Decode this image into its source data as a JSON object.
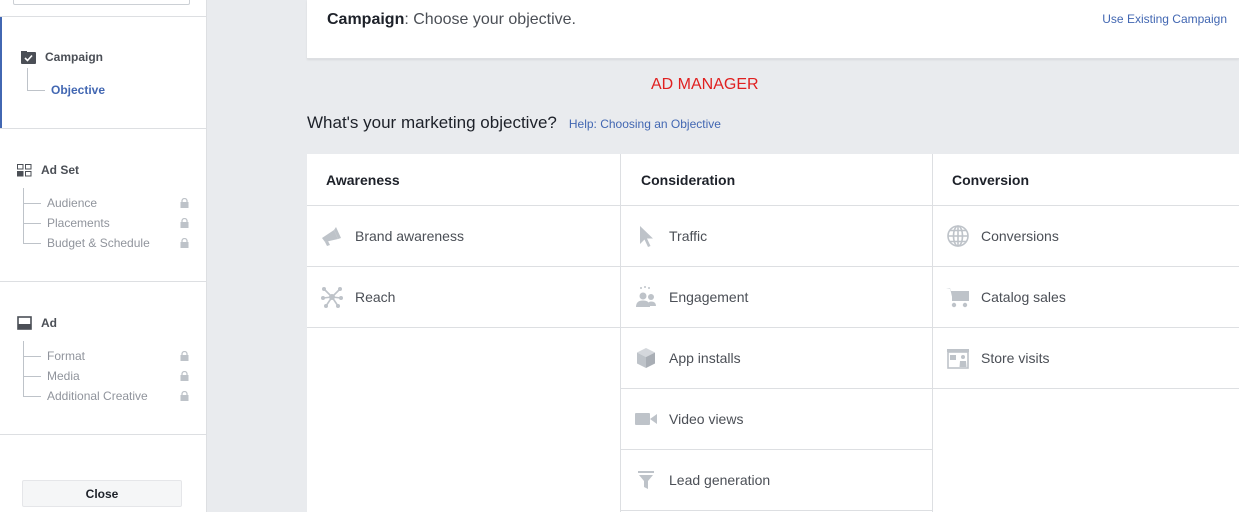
{
  "sidebar": {
    "campaign": {
      "label": "Campaign",
      "icon": "checkbox-icon",
      "items": [
        {
          "label": "Objective",
          "active": true
        }
      ]
    },
    "ad_set": {
      "label": "Ad Set",
      "icon": "grid-icon",
      "items": [
        {
          "label": "Audience",
          "locked": true
        },
        {
          "label": "Placements",
          "locked": true
        },
        {
          "label": "Budget & Schedule",
          "locked": true
        }
      ]
    },
    "ad": {
      "label": "Ad",
      "icon": "ad-layout-icon",
      "items": [
        {
          "label": "Format",
          "locked": true
        },
        {
          "label": "Media",
          "locked": true
        },
        {
          "label": "Additional Creative",
          "locked": true
        }
      ]
    },
    "close_label": "Close"
  },
  "header": {
    "title_bold": "Campaign",
    "title_rest": ": Choose your objective.",
    "link": "Use Existing Campaign"
  },
  "banner": "AD MANAGER",
  "question": {
    "text": "What's your marketing objective?",
    "help": "Help: Choosing an Objective"
  },
  "columns": [
    {
      "title": "Awareness",
      "items": [
        {
          "label": "Brand awareness",
          "icon": "megaphone-icon"
        },
        {
          "label": "Reach",
          "icon": "reach-icon"
        }
      ]
    },
    {
      "title": "Consideration",
      "items": [
        {
          "label": "Traffic",
          "icon": "cursor-icon"
        },
        {
          "label": "Engagement",
          "icon": "people-icon"
        },
        {
          "label": "App installs",
          "icon": "box-icon"
        },
        {
          "label": "Video views",
          "icon": "video-camera-icon"
        },
        {
          "label": "Lead generation",
          "icon": "funnel-icon"
        }
      ]
    },
    {
      "title": "Conversion",
      "items": [
        {
          "label": "Conversions",
          "icon": "globe-icon"
        },
        {
          "label": "Catalog sales",
          "icon": "cart-icon"
        },
        {
          "label": "Store visits",
          "icon": "store-icon"
        }
      ]
    }
  ],
  "colors": {
    "accent": "#4267b2",
    "banner": "#e02020",
    "icon": "#bec3c9"
  }
}
